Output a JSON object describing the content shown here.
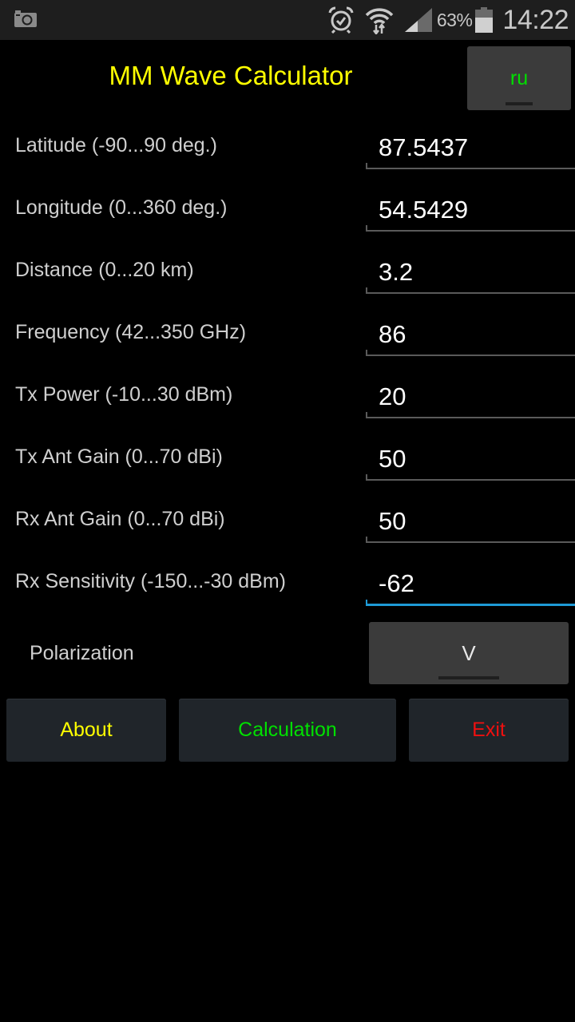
{
  "status_bar": {
    "left_icons": [
      "camera-icon"
    ],
    "right_icons": [
      "alarm-icon",
      "wifi-icon",
      "signal-icon",
      "battery-icon"
    ],
    "battery_percent": "63%",
    "time": "14:22"
  },
  "header": {
    "title": "MM Wave Calculator",
    "language_button": "ru"
  },
  "form": {
    "fields": [
      {
        "label": "Latitude (-90...90 deg.)",
        "value": "87.5437"
      },
      {
        "label": "Longitude (0...360 deg.)",
        "value": "54.5429"
      },
      {
        "label": "Distance (0...20 km)",
        "value": "3.2"
      },
      {
        "label": "Frequency (42...350 GHz)",
        "value": "86"
      },
      {
        "label": "Tx Power (-10...30 dBm)",
        "value": "20"
      },
      {
        "label": "Tx Ant Gain (0...70 dBi)",
        "value": "50"
      },
      {
        "label": "Rx Ant Gain (0...70 dBi)",
        "value": "50"
      },
      {
        "label": "Rx Sensitivity (-150...-30 dBm)",
        "value": "-62",
        "focused": true
      }
    ],
    "polarization": {
      "label": "Polarization",
      "selected": "V"
    }
  },
  "actions": {
    "about": "About",
    "calculation": "Calculation",
    "exit": "Exit"
  },
  "colors": {
    "title": "#ffff00",
    "about": "#ffff00",
    "calculation": "#00e000",
    "exit": "#ee1010",
    "focus_underline": "#1e9ad6"
  }
}
